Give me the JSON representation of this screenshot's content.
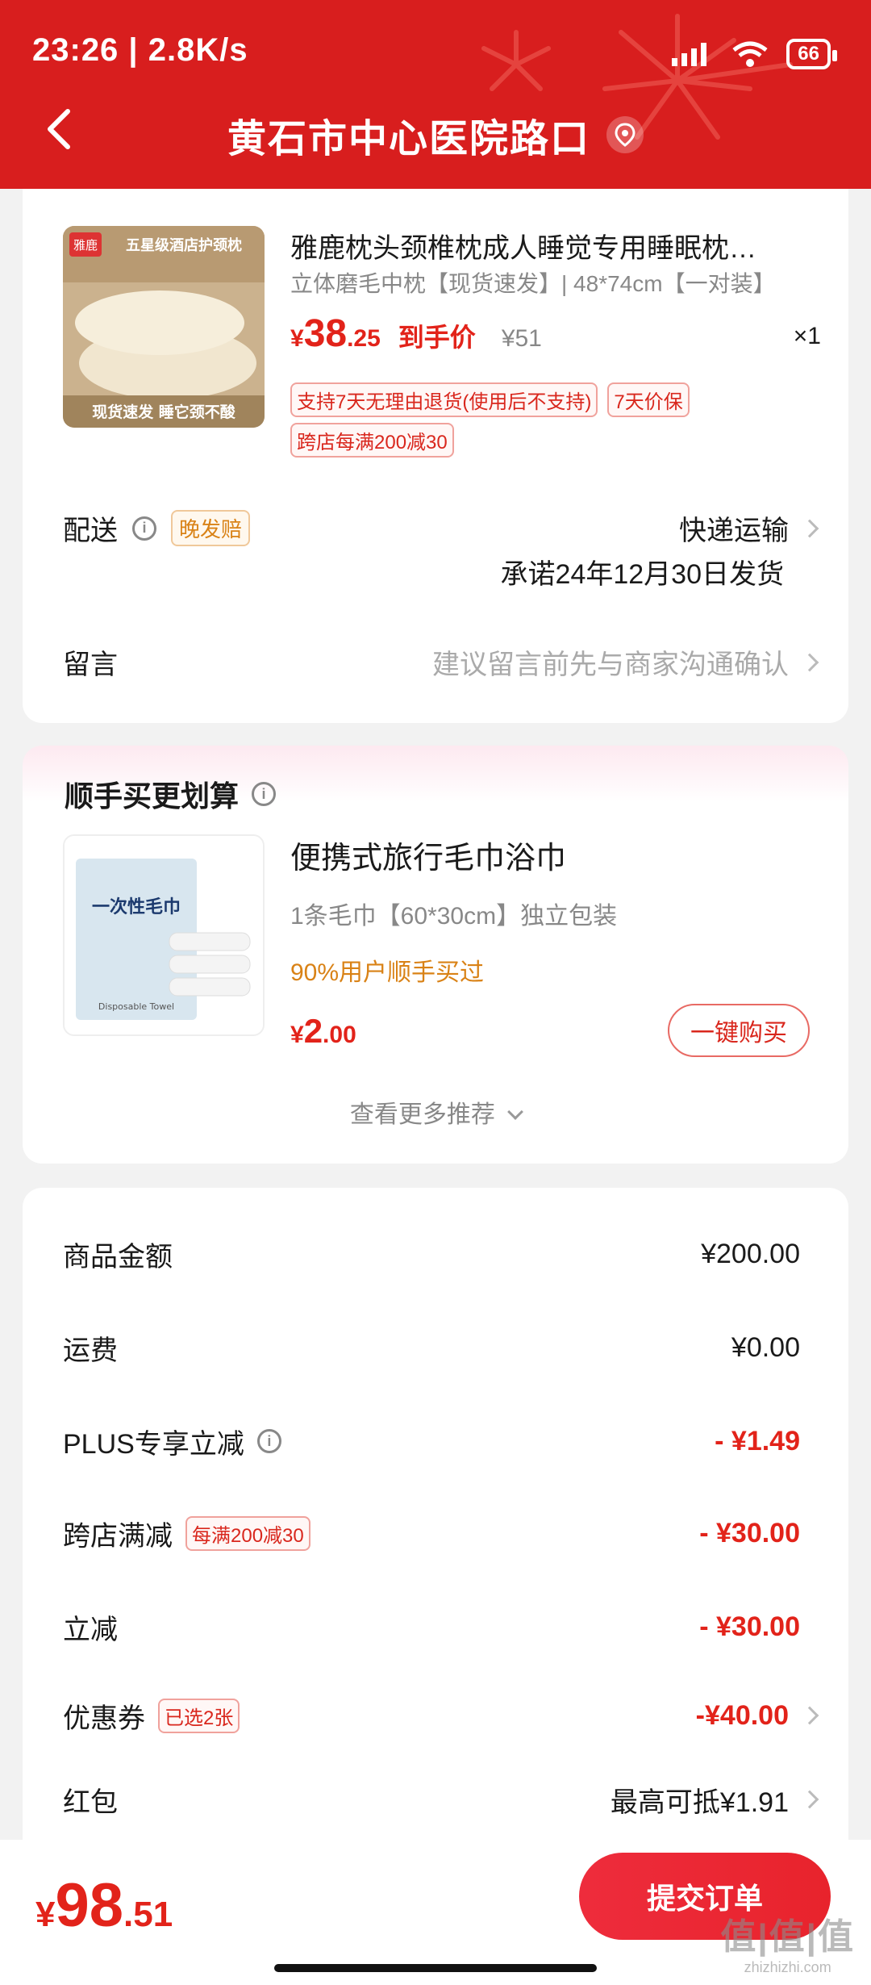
{
  "status_bar": {
    "time_speed": "23:26 | 2.8K/s",
    "battery": "66"
  },
  "header": {
    "title": "黄石市中心医院路口"
  },
  "product": {
    "brand": "雅鹿",
    "image_headline": "五星级酒店护颈枕",
    "image_caption": "现货速发 睡它颈不酸",
    "name": "雅鹿枕头颈椎枕成人睡觉专用睡眠枕…",
    "spec": "立体磨毛中枕【现货速发】| 48*74cm【一对装】",
    "currency": "¥",
    "price_int": "38",
    "price_dec": ".25",
    "price_label": "到手价",
    "original_price": "¥51",
    "quantity": "×1",
    "tags": [
      "支持7天无理由退货(使用后不支持)",
      "7天价保"
    ],
    "promo_tag": "跨店每满200减30"
  },
  "delivery": {
    "label": "配送",
    "late_tag": "晚发赔",
    "method": "快递运输",
    "promise": "承诺24年12月30日发货"
  },
  "message": {
    "label": "留言",
    "placeholder": "建议留言前先与商家沟通确认"
  },
  "addon": {
    "section_title": "顺手买更划算",
    "image_label": "一次性毛巾",
    "image_sub": "Disposable Towel",
    "name": "便携式旅行毛巾浴巾",
    "spec": "1条毛巾【60*30cm】独立包装",
    "percent": "90%用户顺手买过",
    "currency": "¥",
    "price_int": "2",
    "price_dec": ".00",
    "buy_label": "一键购买",
    "more_label": "查看更多推荐"
  },
  "summary": {
    "goods_label": "商品金额",
    "goods_value": "¥200.00",
    "shipping_label": "运费",
    "shipping_value": "¥0.00",
    "plus_label": "PLUS专享立减",
    "plus_value": "- ¥1.49",
    "cross_label": "跨店满减",
    "cross_tag": "每满200减30",
    "cross_value": "- ¥30.00",
    "instant_label": "立减",
    "instant_value": "- ¥30.00",
    "coupon_label": "优惠券",
    "coupon_tag": "已选2张",
    "coupon_value": "-¥40.00",
    "redpacket_label": "红包",
    "redpacket_value": "最高可抵¥1.91"
  },
  "footer": {
    "currency": "¥",
    "total_int": "98",
    "total_dec": ".51",
    "submit_label": "提交订单",
    "watermark": "值|值|值",
    "watermark_url": "zhizhizhi.com"
  },
  "colors": {
    "brand_red": "#d81e1e",
    "price_red": "#e2231a",
    "accent_orange": "#d98216"
  }
}
